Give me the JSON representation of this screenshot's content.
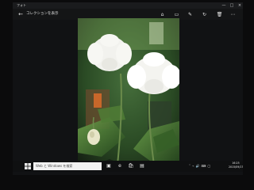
{
  "window": {
    "app_title": "フォト"
  },
  "toolbar": {
    "back_label": "←",
    "collection_link": "コレクションを表示"
  },
  "icons": {
    "title_controls": [
      "minimize-icon",
      "maximize-icon",
      "close-icon"
    ],
    "toolbar": [
      "share-icon",
      "slideshow-icon",
      "edit-icon",
      "rotate-icon",
      "delete-icon",
      "more-icon"
    ]
  },
  "taskbar": {
    "search_placeholder": "Web と Windows を検索",
    "clock_time": "16:25",
    "clock_date": "2015/09/17"
  },
  "colors": {
    "accent": "#ffffff",
    "background": "#111214",
    "taskbar": "#0f1011"
  }
}
